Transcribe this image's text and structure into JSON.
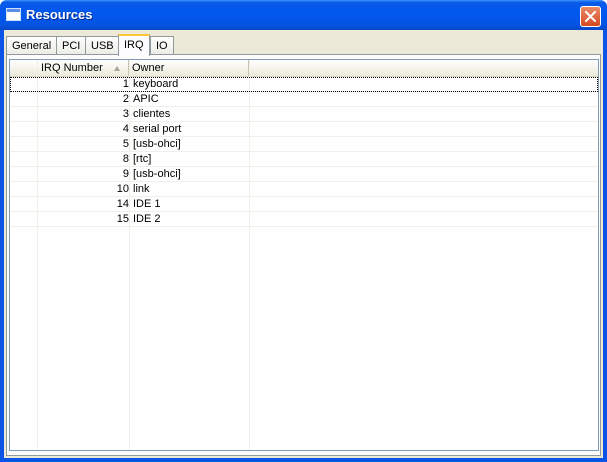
{
  "window": {
    "title": "Resources"
  },
  "tabs": [
    {
      "label": "General",
      "active": false
    },
    {
      "label": "PCI",
      "active": false
    },
    {
      "label": "USB",
      "active": false
    },
    {
      "label": "IRQ",
      "active": true
    },
    {
      "label": "IO",
      "active": false
    }
  ],
  "table": {
    "columns": [
      {
        "label": ""
      },
      {
        "label": "IRQ Number",
        "sorted": "ascending"
      },
      {
        "label": "Owner"
      },
      {
        "label": ""
      }
    ],
    "rows": [
      {
        "irq": "1",
        "owner": "keyboard",
        "focused": true
      },
      {
        "irq": "2",
        "owner": "APIC"
      },
      {
        "irq": "3",
        "owner": "clientes"
      },
      {
        "irq": "4",
        "owner": "serial port"
      },
      {
        "irq": "5",
        "owner": "[usb-ohci]"
      },
      {
        "irq": "8",
        "owner": "[rtc]"
      },
      {
        "irq": "9",
        "owner": "[usb-ohci]"
      },
      {
        "irq": "10",
        "owner": "link"
      },
      {
        "irq": "14",
        "owner": "IDE 1"
      },
      {
        "irq": "15",
        "owner": "IDE 2"
      }
    ]
  },
  "icons": {
    "title": "window-icon",
    "close": "close-icon",
    "sort": "sort-ascending-icon"
  },
  "colors": {
    "titlebar": "#0058ee",
    "tab_highlight": "#ffc83c",
    "client": "#ece9d8"
  }
}
